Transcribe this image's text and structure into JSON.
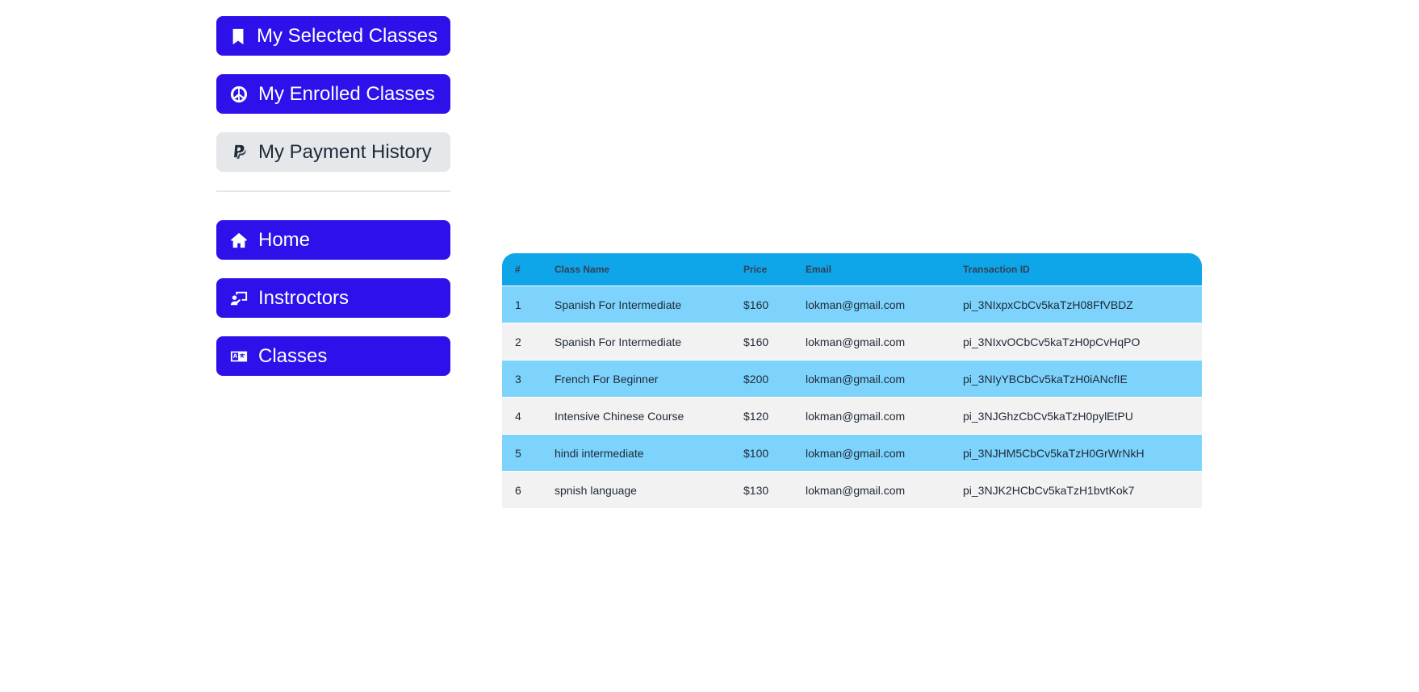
{
  "sidebar": {
    "top_items": [
      {
        "label": "My Selected Classes",
        "icon": "bookmark-icon",
        "active": false
      },
      {
        "label": "My Enrolled Classes",
        "icon": "peace-icon",
        "active": false
      },
      {
        "label": "My Payment History",
        "icon": "paypal-icon",
        "active": true
      }
    ],
    "bottom_items": [
      {
        "label": "Home",
        "icon": "home-icon"
      },
      {
        "label": "Instroctors",
        "icon": "chalkboard-teacher-icon"
      },
      {
        "label": "Classes",
        "icon": "language-icon"
      }
    ]
  },
  "colors": {
    "nav_button": "#2e10ea",
    "nav_active": "#e5e7eb",
    "table_header": "#0ea5e9",
    "row_odd": "#7dd3fc",
    "row_even": "#f2f2f2"
  },
  "table": {
    "headers": [
      "#",
      "Class Name",
      "Price",
      "Email",
      "Transaction ID"
    ],
    "rows": [
      [
        "1",
        "Spanish For Intermediate",
        "$160",
        "lokman@gmail.com",
        "pi_3NIxpxCbCv5kaTzH08FfVBDZ"
      ],
      [
        "2",
        "Spanish For Intermediate",
        "$160",
        "lokman@gmail.com",
        "pi_3NIxvOCbCv5kaTzH0pCvHqPO"
      ],
      [
        "3",
        "French For Beginner",
        "$200",
        "lokman@gmail.com",
        "pi_3NIyYBCbCv5kaTzH0iANcfIE"
      ],
      [
        "4",
        "Intensive Chinese Course",
        "$120",
        "lokman@gmail.com",
        "pi_3NJGhzCbCv5kaTzH0pylEtPU"
      ],
      [
        "5",
        "hindi intermediate",
        "$100",
        "lokman@gmail.com",
        "pi_3NJHM5CbCv5kaTzH0GrWrNkH"
      ],
      [
        "6",
        "spnish language",
        "$130",
        "lokman@gmail.com",
        "pi_3NJK2HCbCv5kaTzH1bvtKok7"
      ]
    ]
  }
}
